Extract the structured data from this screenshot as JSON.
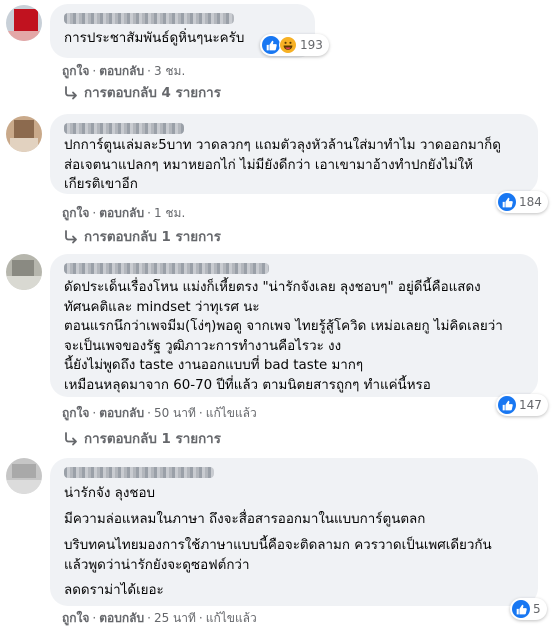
{
  "colors": {
    "bubble": "#f0f2f5",
    "meta": "#65676b",
    "like": "#1877f2",
    "haha": "#f7b125"
  },
  "labels": {
    "like": "ถูกใจ",
    "reply": "ตอบกลับ",
    "edited": "แก้ไขแล้ว",
    "separator": "·"
  },
  "comments": [
    {
      "text": "การประชาสัมพันธ์ดูหิ่นๆนะครับ",
      "time": "3 ชม.",
      "reaction_count": "193",
      "reaction_icons": [
        "like-icon",
        "haha-icon"
      ],
      "replies_label": "การตอบกลับ 4 รายการ"
    },
    {
      "text": "ปกการ์ตูนเล่มละ5บาท วาดลวกๆ แถมตัวลุงหัวล้านใส่มาทำไม วาดออกมาก็ดู\nส่อเจตนาแปลกๆ หมาหยอกไก่ ไม่มียังดีกว่า เอาเขามาอ้างทำปกยังไม่ให้\nเกียรติเขาอีก",
      "time": "1 ชม.",
      "reaction_count": "184",
      "reaction_icons": [
        "like-icon"
      ],
      "replies_label": "การตอบกลับ 1 รายการ"
    },
    {
      "text": "ดัดประเด็นเรื่องโหน แม่งก็เหี้ยตรง \"น่ารักจังเลย ลุงชอบๆ\" อยู่ดีนี้คือแสดง\nทัศนคติและ mindset ว่าทุเรศ นะ\nตอนแรกนึกว่าเพจมีม(โง่ๆ)พอดู จากเพจ ไทยรู้สู้โควิด เหม่อเลยกู ไม่คิดเลยว่า\nจะเป็นเพจของรัฐ วูฒิภาวะการทำงานคือไรวะ งง\nนี้ยังไม่พูดถึง taste งานออกแบบที่ bad taste มากๆ\nเหมือนหลุดมาจาก 60-70 ปีที่แล้ว ตามนิตยสารถูกๆ ทำแค่นี้หรอ",
      "time": "50 นาที",
      "edited": true,
      "reaction_count": "147",
      "reaction_icons": [
        "like-icon"
      ],
      "replies_label": "การตอบกลับ 1 รายการ"
    },
    {
      "paragraphs": [
        "น่ารักจัง ลุงชอบ",
        "มีความล่อแหลมในภาษา ถึงจะสื่อสารออกมาในแบบการ์ตูนตลก",
        "บริบทคนไทยมองการใช้ภาษาแบบนี้คือจะติดลามก ควรวาดเป็นเพศเดียวกัน\nแล้วพูดว่าน่ารักยังจะดูซอฟต์กว่า",
        "ลดดราม่าได้เยอะ"
      ],
      "time": "25 นาที",
      "edited": true,
      "reaction_count": "5",
      "reaction_icons": [
        "like-icon"
      ]
    }
  ]
}
